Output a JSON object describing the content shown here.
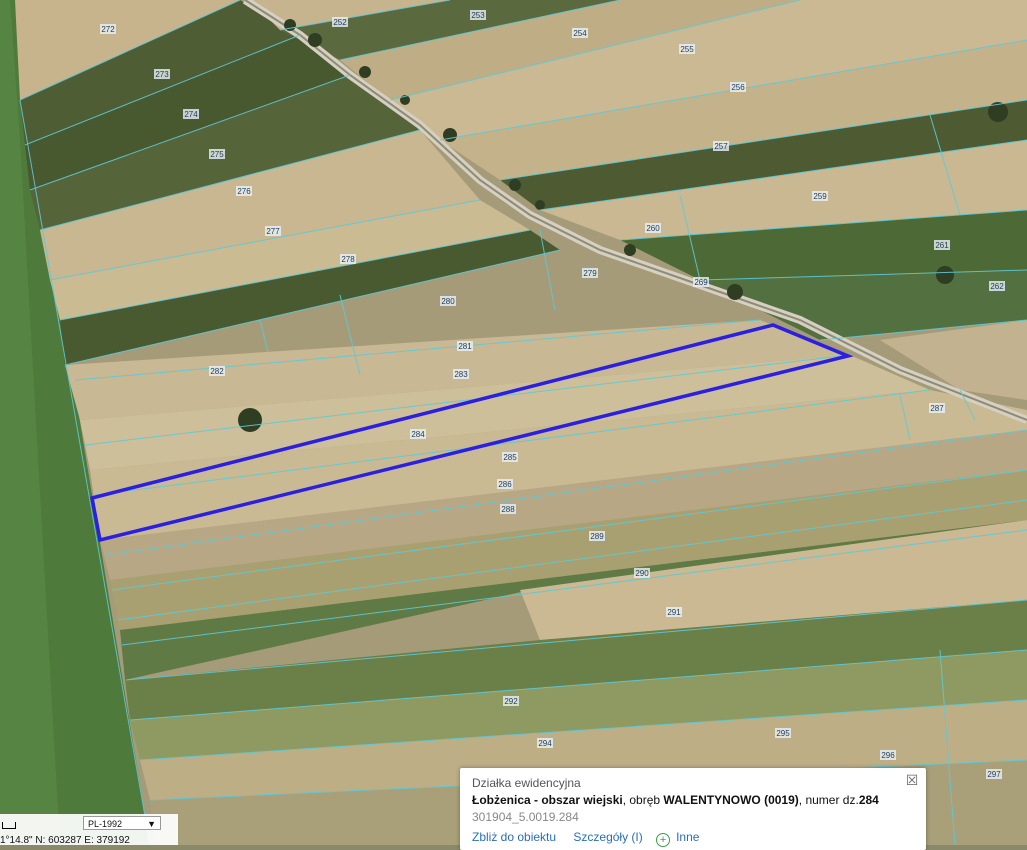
{
  "map": {
    "parcel_labels": [
      "252",
      "253",
      "254",
      "255",
      "256",
      "257",
      "259",
      "260",
      "261",
      "262",
      "269",
      "272",
      "273",
      "274",
      "275",
      "276",
      "277",
      "278",
      "279",
      "280",
      "281",
      "282",
      "283",
      "284",
      "285",
      "286",
      "287",
      "288",
      "289",
      "290",
      "291",
      "292",
      "294",
      "295",
      "296",
      "297"
    ],
    "selected_parcel": "284",
    "selection_color": "#2b1fe0",
    "boundary_color": "#5fc9d6"
  },
  "popup": {
    "title": "Działka ewidencyjna",
    "desc_prefix": "Łobżenica - obszar wiejski",
    "desc_mid": ", obręb ",
    "desc_obreb": "WALENTYNOWO (0019)",
    "desc_suffix": ", numer dz.",
    "desc_number": "284",
    "id": "301904_5.0019.284",
    "zoom_label": "Zbliż do obiektu",
    "details_label": "Szczegóły (I)",
    "other_label": "Inne",
    "close_icon": "close-icon"
  },
  "coordbar": {
    "crs": "PL-1992",
    "coords_text": "1°14.8\"  N: 603287    E: 379192"
  }
}
